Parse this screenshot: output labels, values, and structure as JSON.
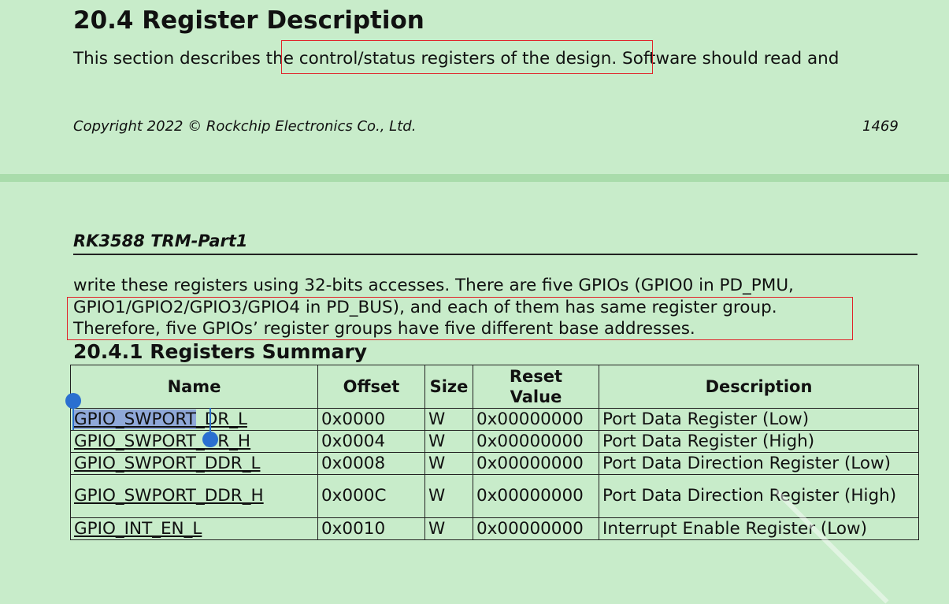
{
  "section": {
    "title": "20.4 Register Description",
    "intro_line": "This section describes the control/status registers of the design. Software should read and"
  },
  "footer": {
    "copyright": "Copyright 2022 © Rockchip Electronics Co., Ltd.",
    "page_number": "1469"
  },
  "next_page": {
    "header": "RK3588 TRM-Part1",
    "para_lines": [
      "write these registers using 32-bits accesses. There are five GPIOs (GPIO0 in PD_PMU,",
      "GPIO1/GPIO2/GPIO3/GPIO4 in PD_BUS), and each of them has same register group.",
      "Therefore, five GPIOs’ register groups have five different base addresses."
    ],
    "subsection_title": "20.4.1 Registers Summary"
  },
  "table": {
    "headers": {
      "name": "Name",
      "offset": "Offset",
      "size": "Size",
      "reset_line1": "Reset",
      "reset_line2": "Value",
      "description": "Description"
    },
    "rows": [
      {
        "name_selected": "GPIO_SWPORT",
        "name_rest": "_DR_L",
        "offset": "0x0000",
        "size": "W",
        "reset": "0x00000000",
        "description": "Port Data Register (Low)"
      },
      {
        "name": "GPIO_SWPORT_DR_H",
        "offset": "0x0004",
        "size": "W",
        "reset": "0x00000000",
        "description": "Port Data Register (High)"
      },
      {
        "name": "GPIO_SWPORT_DDR_L",
        "offset": "0x0008",
        "size": "W",
        "reset": "0x00000000",
        "description": "Port Data Direction Register (Low)"
      },
      {
        "name": "GPIO_SWPORT_DDR_H",
        "offset": "0x000C",
        "size": "W",
        "reset": "0x00000000",
        "description": "Port Data Direction Register (High)"
      },
      {
        "name": "GPIO_INT_EN_L",
        "offset": "0x0010",
        "size": "W",
        "reset": "0x00000000",
        "description": "Interrupt Enable Register (Low)"
      }
    ]
  },
  "colors": {
    "background": "#c8ecca",
    "highlight_box": "#e0242a",
    "selection": "#8fa8d8",
    "selection_handle": "#2a6fd0"
  }
}
